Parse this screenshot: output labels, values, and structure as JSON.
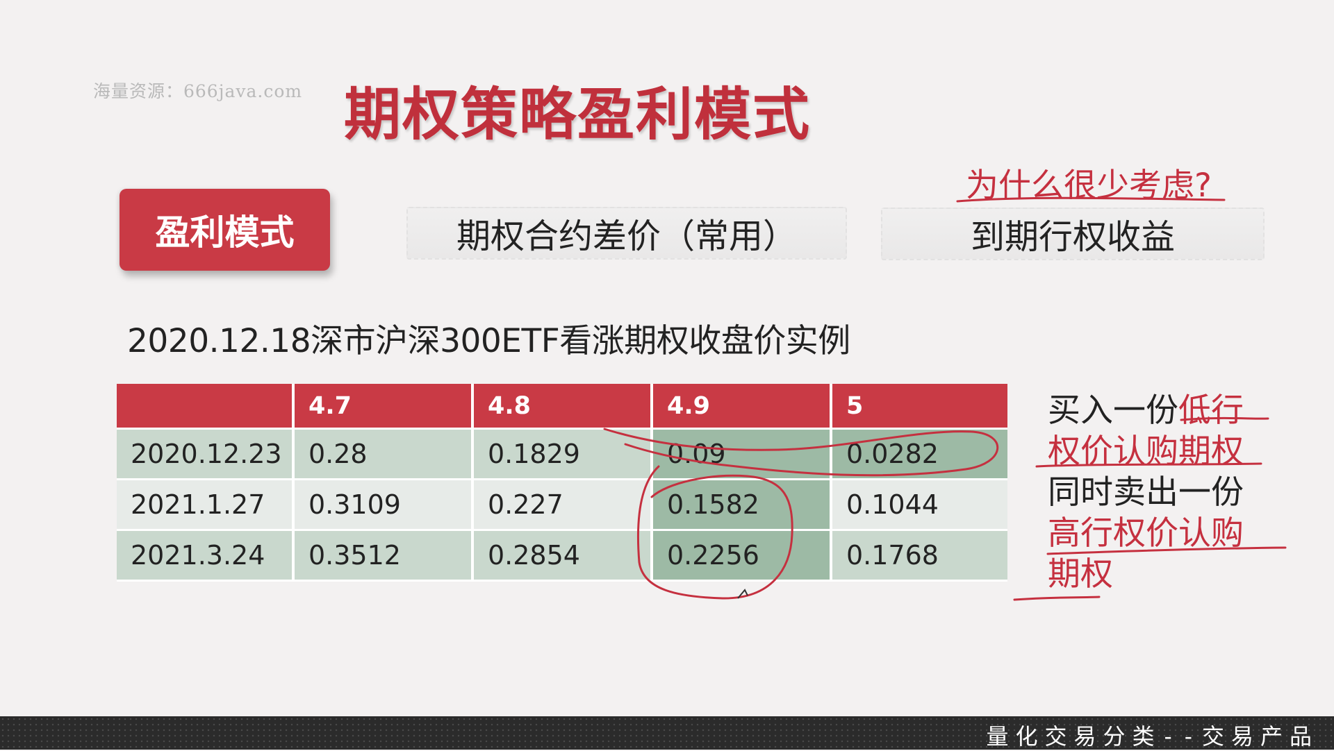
{
  "watermark": "海量资源：666java.com",
  "title": "期权策略盈利模式",
  "mode_button": "盈利模式",
  "options": [
    "期权合约差价（常用）",
    "到期行权收益"
  ],
  "annotation_why": "为什么很少考虑?",
  "subtitle": "2020.12.18深市沪深300ETF看涨期权收盘价实例",
  "table": {
    "headers": [
      "",
      "4.7",
      "4.8",
      "4.9",
      "5"
    ],
    "rows": [
      [
        "2020.12.23",
        "0.28",
        "0.1829",
        "0.09",
        "0.0282"
      ],
      [
        "2021.1.27",
        "0.3109",
        "0.227",
        "0.1582",
        "0.1044"
      ],
      [
        "2021.3.24",
        "0.3512",
        "0.2854",
        "0.2256",
        "0.1768"
      ]
    ]
  },
  "side_note": {
    "p1": "买入一份",
    "p2": "低行",
    "p3": "权价认购期权",
    "p4": "同时卖出一份",
    "p5": "高行权价认购",
    "p6": "期权"
  },
  "footer": "量化交易分类--交易产品",
  "colors": {
    "accent_red": "#c93a45",
    "title_red": "#c0303c",
    "cell_green": "#c9d8cd",
    "highlight_green": "#9dbaa5",
    "footer_bg": "#2b2b2b"
  }
}
